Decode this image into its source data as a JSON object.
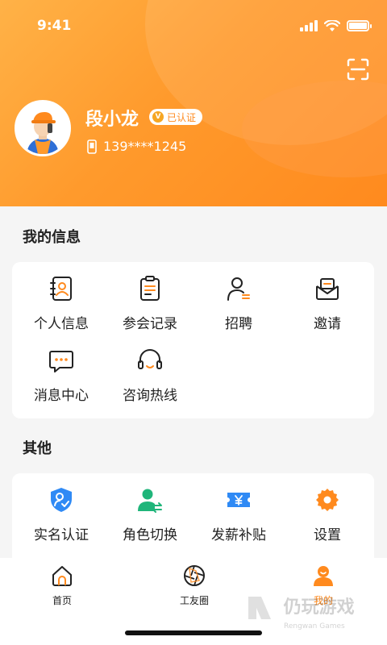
{
  "status_bar": {
    "time": "9:41"
  },
  "profile": {
    "name": "段小龙",
    "verified_label": "已认证",
    "verified_mark": "V",
    "phone": "139****1245"
  },
  "my_info": {
    "title": "我的信息",
    "items": [
      {
        "label": "个人信息",
        "icon": "contact-book-icon"
      },
      {
        "label": "参会记录",
        "icon": "clipboard-icon"
      },
      {
        "label": "招聘",
        "icon": "recruit-person-icon"
      },
      {
        "label": "邀请",
        "icon": "envelope-icon"
      },
      {
        "label": "消息中心",
        "icon": "chat-bubble-icon"
      },
      {
        "label": "咨询热线",
        "icon": "headset-icon"
      }
    ]
  },
  "other": {
    "title": "其他",
    "items": [
      {
        "label": "实名认证",
        "icon": "shield-user-icon"
      },
      {
        "label": "角色切换",
        "icon": "user-switch-icon"
      },
      {
        "label": "发薪补贴",
        "icon": "ticket-yen-icon"
      },
      {
        "label": "设置",
        "icon": "gear-icon"
      }
    ]
  },
  "tabbar": {
    "items": [
      {
        "label": "首页",
        "icon": "home-icon",
        "active": false
      },
      {
        "label": "工友圈",
        "icon": "aperture-icon",
        "active": false
      },
      {
        "label": "我的",
        "icon": "user-icon",
        "active": true
      }
    ]
  },
  "watermark": {
    "title": "仍玩游戏",
    "subtitle": "Rengwan Games"
  },
  "colors": {
    "accent": "#ff8a1e",
    "blue": "#2f8af5",
    "green": "#1fb57a"
  }
}
